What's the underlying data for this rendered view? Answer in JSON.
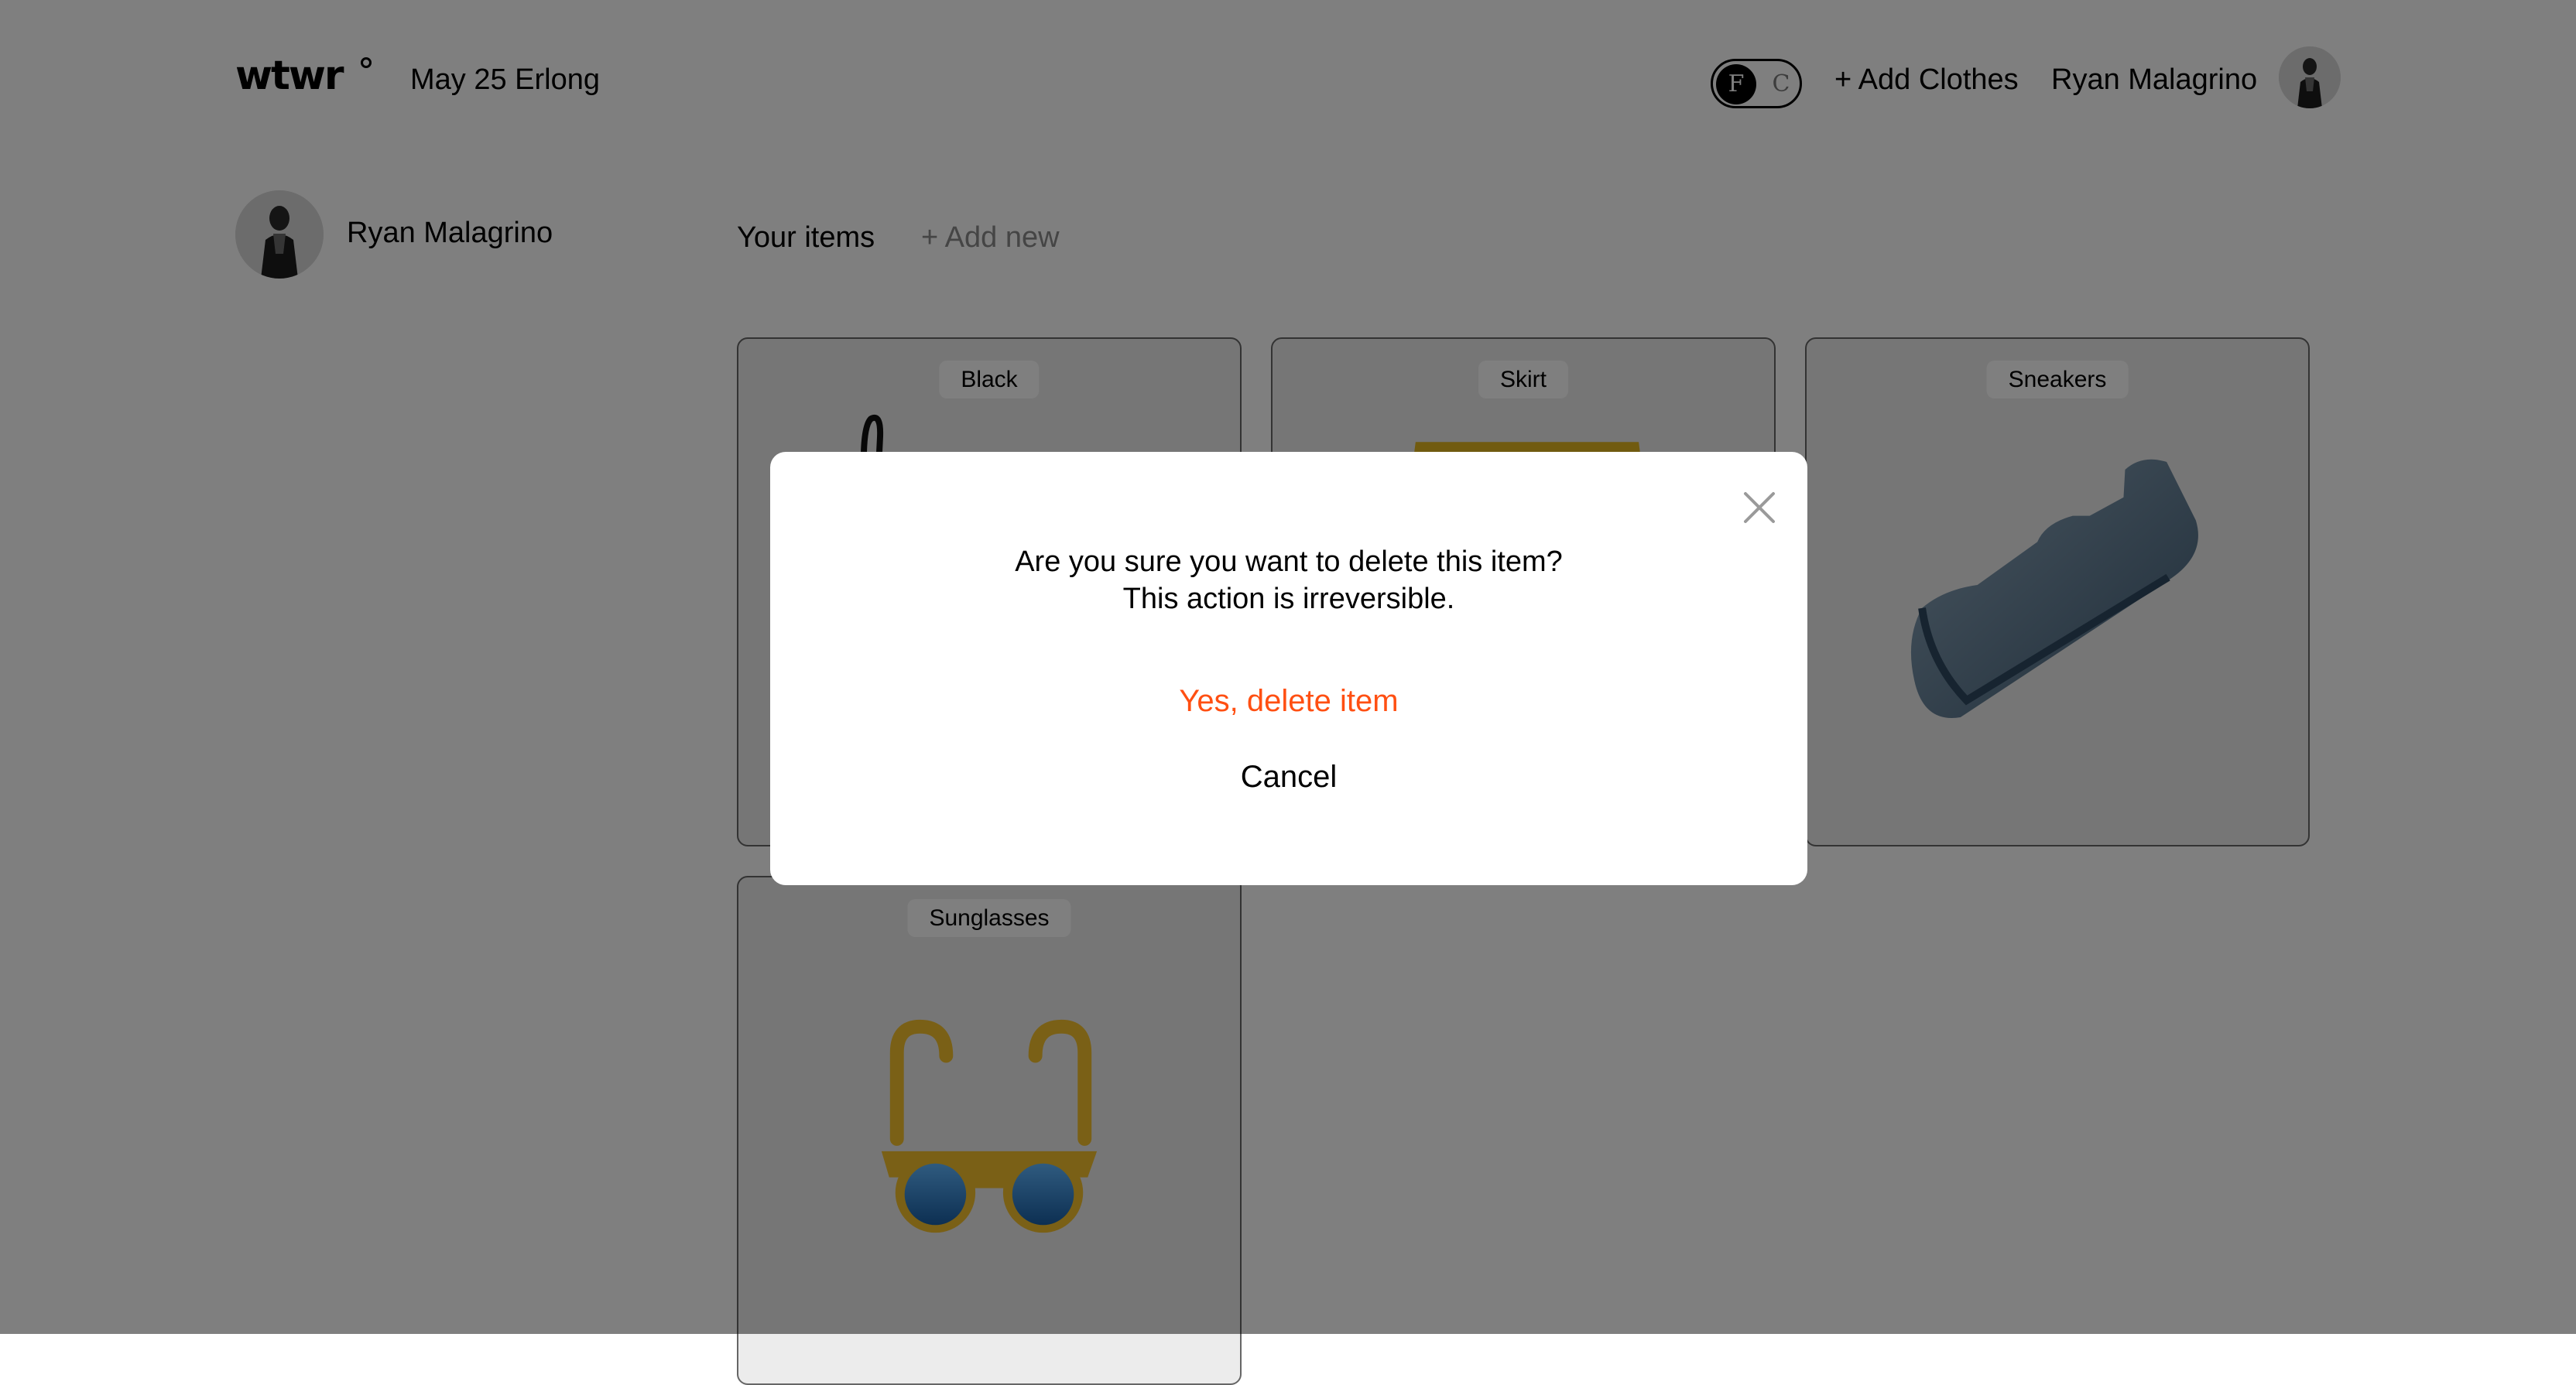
{
  "header": {
    "logo": "wtwr",
    "date_location": "May 25 Erlong",
    "temp_toggle": {
      "f": "F",
      "c": "C",
      "selected": "F"
    },
    "add_clothes": "+ Add Clothes",
    "username": "Ryan Malagrino"
  },
  "sidebar": {
    "username": "Ryan Malagrino"
  },
  "main": {
    "section_title": "Your items",
    "add_new": "+ Add new",
    "items": [
      {
        "label": "Black",
        "icon": "black-item-icon"
      },
      {
        "label": "Skirt",
        "icon": "skirt-icon"
      },
      {
        "label": "Sneakers",
        "icon": "sneaker-icon"
      },
      {
        "label": "Sunglasses",
        "icon": "sunglasses-icon"
      }
    ]
  },
  "modal": {
    "message_line1": "Are you sure you want to delete this item?",
    "message_line2": "This action is irreversible.",
    "confirm_label": "Yes, delete item",
    "cancel_label": "Cancel",
    "close_icon": "close-icon"
  },
  "colors": {
    "overlay": "rgba(0,0,0,0.5)",
    "danger": "#ff4f12",
    "muted": "#8a8a8a"
  }
}
